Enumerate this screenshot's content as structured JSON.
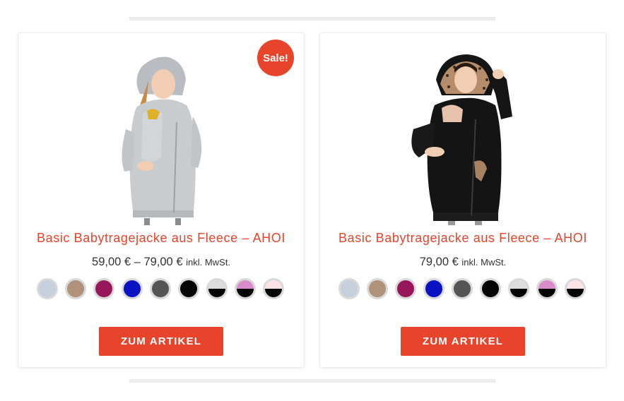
{
  "products": [
    {
      "sale_badge": "Sale!",
      "title": "Basic Babytragejacke aus Fleece – AHOI",
      "price": "59,00 € – 79,00 €",
      "tax_note": "inkl. MwSt.",
      "button_label": "ZUM ARTIKEL",
      "swatches": [
        {
          "top": "#c6d0dc",
          "bottom": "#c6d0dc"
        },
        {
          "top": "#b0917a",
          "bottom": "#b0917a"
        },
        {
          "top": "#96185a",
          "bottom": "#96185a"
        },
        {
          "top": "#0a12c4",
          "bottom": "#0a12c4"
        },
        {
          "top": "#555555",
          "bottom": "#555555"
        },
        {
          "top": "#050505",
          "bottom": "#050505"
        },
        {
          "top": "#dcdcdc",
          "bottom": "#050505"
        },
        {
          "top": "#d98cc9",
          "bottom": "#050505"
        },
        {
          "top": "#fbe3e6",
          "bottom": "#050505"
        }
      ]
    },
    {
      "title": "Basic Babytragejacke aus Fleece – AHOI",
      "price": "79,00 €",
      "tax_note": "inkl. MwSt.",
      "button_label": "ZUM ARTIKEL",
      "swatches": [
        {
          "top": "#c6d0dc",
          "bottom": "#c6d0dc"
        },
        {
          "top": "#b0917a",
          "bottom": "#b0917a"
        },
        {
          "top": "#96185a",
          "bottom": "#96185a"
        },
        {
          "top": "#0a12c4",
          "bottom": "#0a12c4"
        },
        {
          "top": "#555555",
          "bottom": "#555555"
        },
        {
          "top": "#050505",
          "bottom": "#050505"
        },
        {
          "top": "#dcdcdc",
          "bottom": "#050505"
        },
        {
          "top": "#d98cc9",
          "bottom": "#050505"
        },
        {
          "top": "#fbe3e6",
          "bottom": "#050505"
        }
      ]
    }
  ],
  "colors": {
    "accent": "#e8432b",
    "divider": "#ececec"
  }
}
